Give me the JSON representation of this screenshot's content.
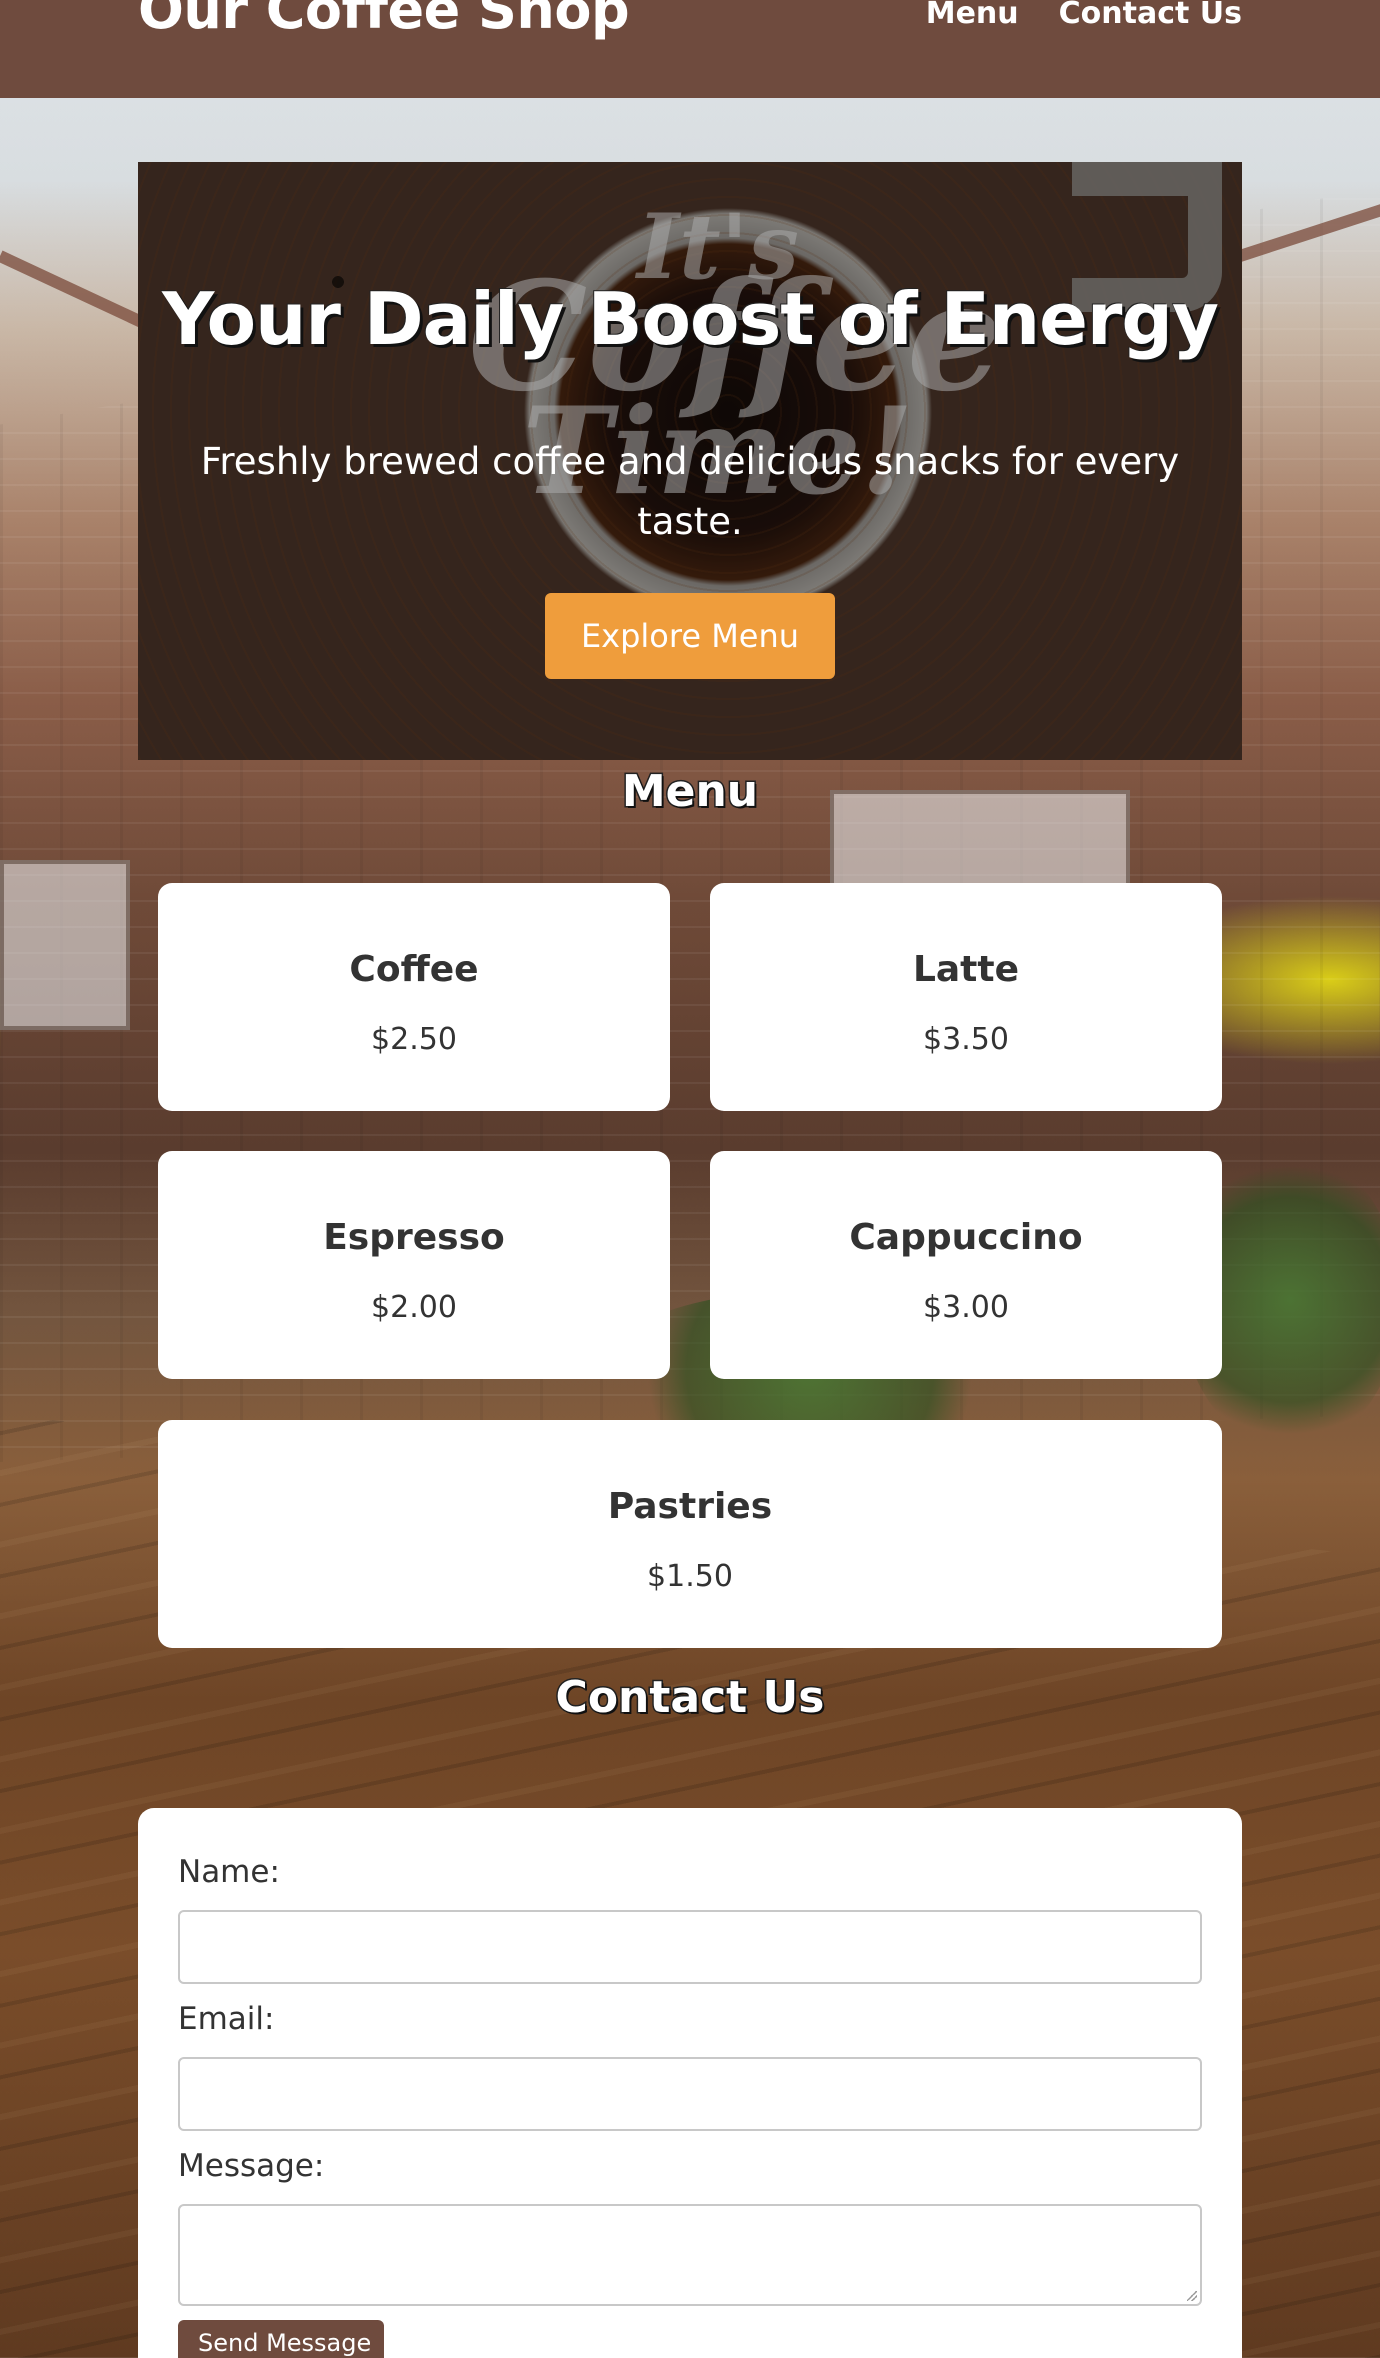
{
  "header": {
    "brand": "Our Coffee Shop",
    "nav": [
      "Menu",
      "Contact Us"
    ]
  },
  "hero": {
    "image_text": [
      "It's",
      "Coffee",
      "Time!"
    ],
    "title": "Your Daily Boost of Energy",
    "subtitle_line1": "Freshly brewed coffee and delicious snacks for every",
    "subtitle_line2": "taste.",
    "button": "Explore Menu"
  },
  "menu": {
    "title": "Menu",
    "items": [
      {
        "name": "Coffee",
        "price": "$2.50"
      },
      {
        "name": "Latte",
        "price": "$3.50"
      },
      {
        "name": "Espresso",
        "price": "$2.00"
      },
      {
        "name": "Cappuccino",
        "price": "$3.00"
      },
      {
        "name": "Pastries",
        "price": "$1.50"
      }
    ]
  },
  "contact": {
    "title": "Contact Us",
    "name_label": "Name:",
    "email_label": "Email:",
    "message_label": "Message:",
    "name_value": "",
    "email_value": "",
    "message_value": "",
    "button": "Send Message"
  },
  "colors": {
    "header_bg": "#6f4b3e",
    "accent_button": "#ef9d3c",
    "card_bg": "#ffffff"
  }
}
